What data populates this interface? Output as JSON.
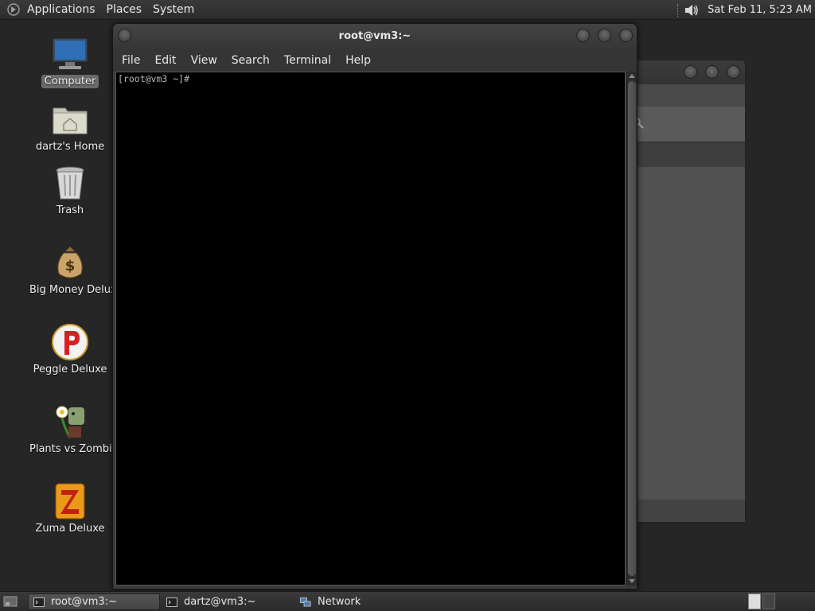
{
  "top_panel": {
    "menus": [
      "Applications",
      "Places",
      "System"
    ],
    "clock": "Sat Feb 11,  5:23 AM"
  },
  "desktop": {
    "icons": [
      {
        "label": "Computer"
      },
      {
        "label": "dartz's Home"
      },
      {
        "label": "Trash"
      },
      {
        "label": "Big Money Delux"
      },
      {
        "label": "Peggle Deluxe"
      },
      {
        "label": "Plants vs Zombie"
      },
      {
        "label": "Zuma Deluxe"
      }
    ]
  },
  "terminal": {
    "title": "root@vm3:~",
    "menu": [
      "File",
      "Edit",
      "View",
      "Search",
      "Terminal",
      "Help"
    ],
    "prompt": "[root@vm3 ~]#"
  },
  "taskbar": {
    "items": [
      {
        "label": "root@vm3:~"
      },
      {
        "label": "dartz@vm3:~"
      },
      {
        "label": "Network"
      }
    ]
  }
}
